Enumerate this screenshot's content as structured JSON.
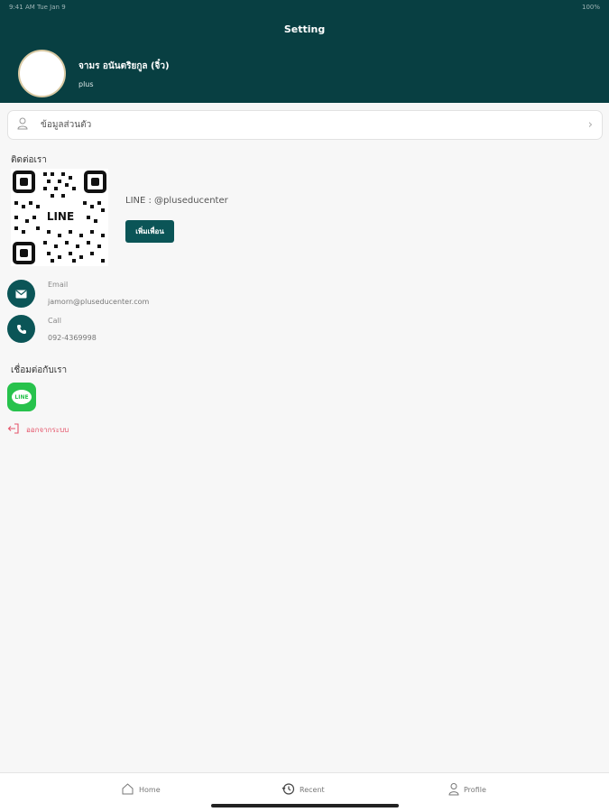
{
  "status_bar": {
    "left": "9:41 AM  Tue Jan 9",
    "right": "100%"
  },
  "header": {
    "title": "Setting",
    "user_name": "จามร อนันตริยกูล (จิ๋ว)",
    "user_role": "plus"
  },
  "profile_row": {
    "label": "ข้อมูลส่วนตัว",
    "icon": "person-icon"
  },
  "contact_section": {
    "title": "ติดต่อเรา",
    "line_id": "LINE : @pluseducenter",
    "qr_logo": "LINE",
    "add_friend_label": "เพิ่มเพื่อน",
    "email": {
      "label": "Email",
      "value": "jamorn@pluseducenter.com",
      "icon": "mail-icon"
    },
    "call": {
      "label": "Call",
      "value": "092-4369998",
      "icon": "phone-icon"
    }
  },
  "connect_section": {
    "title": "เชื่อมต่อกับเรา",
    "line_logo": "LINE"
  },
  "logout": {
    "label": "ออกจากระบบ",
    "icon": "logout-icon"
  },
  "colors": {
    "header_bg": "#083f42",
    "accent": "#0b5557",
    "line_green": "#27c24c",
    "logout_red": "#e5566b"
  },
  "tabs": [
    {
      "label": "Home",
      "icon": "home-icon"
    },
    {
      "label": "Recent",
      "icon": "history-icon"
    },
    {
      "label": "Profile",
      "icon": "person-icon"
    }
  ]
}
